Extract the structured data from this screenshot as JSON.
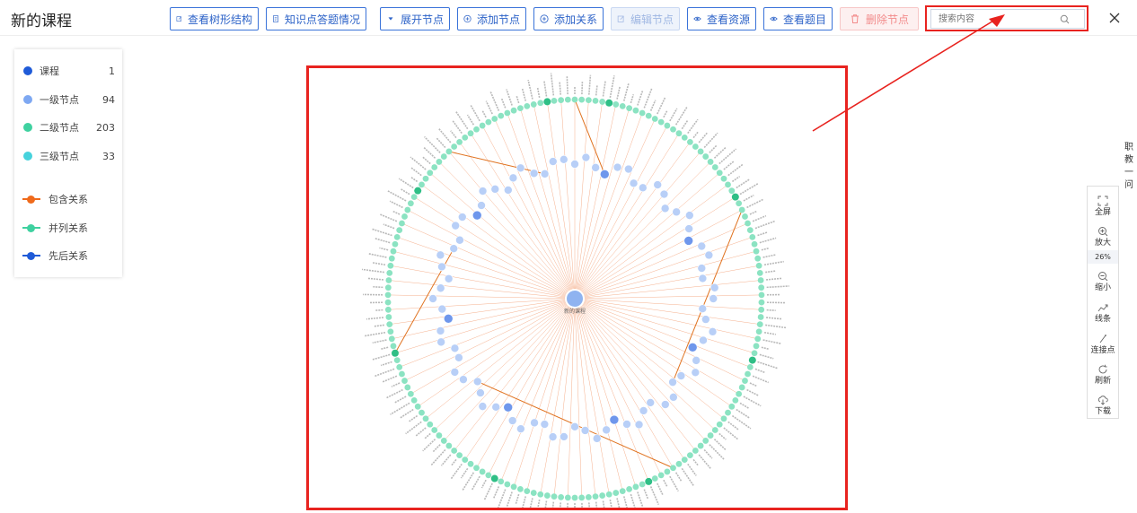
{
  "header": {
    "title": "新的课程",
    "buttons": [
      {
        "label": "查看树形结构",
        "icon": "edit-square-icon",
        "state": "normal"
      },
      {
        "label": "知识点答题情况",
        "icon": "document-icon",
        "state": "normal"
      },
      {
        "label": "展开节点",
        "icon": "caret-down-icon",
        "state": "normal"
      },
      {
        "label": "添加节点",
        "icon": "plus-circle-icon",
        "state": "normal"
      },
      {
        "label": "添加关系",
        "icon": "plus-circle-icon",
        "state": "normal"
      },
      {
        "label": "编辑节点",
        "icon": "edit-square-icon",
        "state": "disabled"
      },
      {
        "label": "查看资源",
        "icon": "eye-icon",
        "state": "normal"
      },
      {
        "label": "查看题目",
        "icon": "eye-icon",
        "state": "normal"
      },
      {
        "label": "删除节点",
        "icon": "trash-icon",
        "state": "danger"
      }
    ],
    "search": {
      "placeholder": "搜索内容",
      "value": ""
    }
  },
  "legend": {
    "nodes": [
      {
        "label": "课程",
        "count": "1",
        "color": "#1f5bd8"
      },
      {
        "label": "一级节点",
        "count": "94",
        "color": "#7ea8f2"
      },
      {
        "label": "二级节点",
        "count": "203",
        "color": "#3fd1a0"
      },
      {
        "label": "三级节点",
        "count": "33",
        "color": "#46d2dc"
      }
    ],
    "relations": [
      {
        "label": "包含关系",
        "color": "#ef6a1b"
      },
      {
        "label": "并列关系",
        "color": "#3fd1a0"
      },
      {
        "label": "先后关系",
        "color": "#1f5bd8"
      }
    ]
  },
  "graph": {
    "center_label": "新的课程",
    "center_color": "#8fb3f0",
    "inner_ring_color": "#b8cff7",
    "outer_ring_color": "#8be3c2",
    "edge_color": "#f6b08d"
  },
  "toolbox": {
    "items": [
      {
        "label": "全屏",
        "icon": "fullscreen-icon"
      },
      {
        "label": "放大",
        "icon": "zoom-in-icon"
      },
      {
        "label": "缩小",
        "icon": "zoom-out-icon"
      },
      {
        "label": "线条",
        "icon": "line-chart-icon"
      },
      {
        "label": "连接点",
        "icon": "pin-icon"
      },
      {
        "label": "刷新",
        "icon": "refresh-icon"
      },
      {
        "label": "下载",
        "icon": "download-cloud-icon"
      }
    ],
    "zoom": "26%"
  },
  "side_tab": {
    "chars": [
      "职",
      "教",
      "一",
      "问"
    ]
  }
}
